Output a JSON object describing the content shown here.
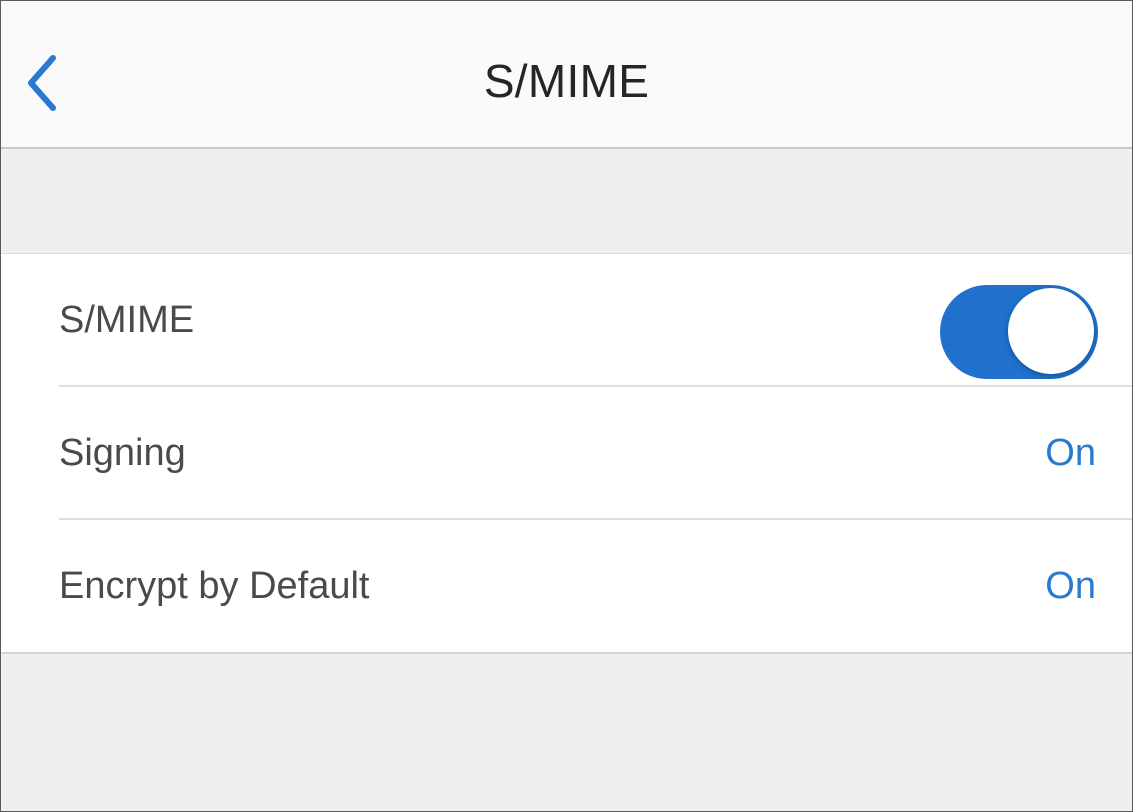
{
  "navbar": {
    "title": "S/MIME",
    "back_icon": "chevron-left-icon"
  },
  "settings": {
    "rows": [
      {
        "label": "S/MIME",
        "control": "toggle",
        "toggle_on": true
      },
      {
        "label": "Signing",
        "value": "On"
      },
      {
        "label": "Encrypt by Default",
        "value": "On"
      }
    ]
  },
  "colors": {
    "accent": "#1f71cb",
    "value_text": "#2a7bd0",
    "background": "#efefef",
    "navbar_background": "#fafafa"
  }
}
